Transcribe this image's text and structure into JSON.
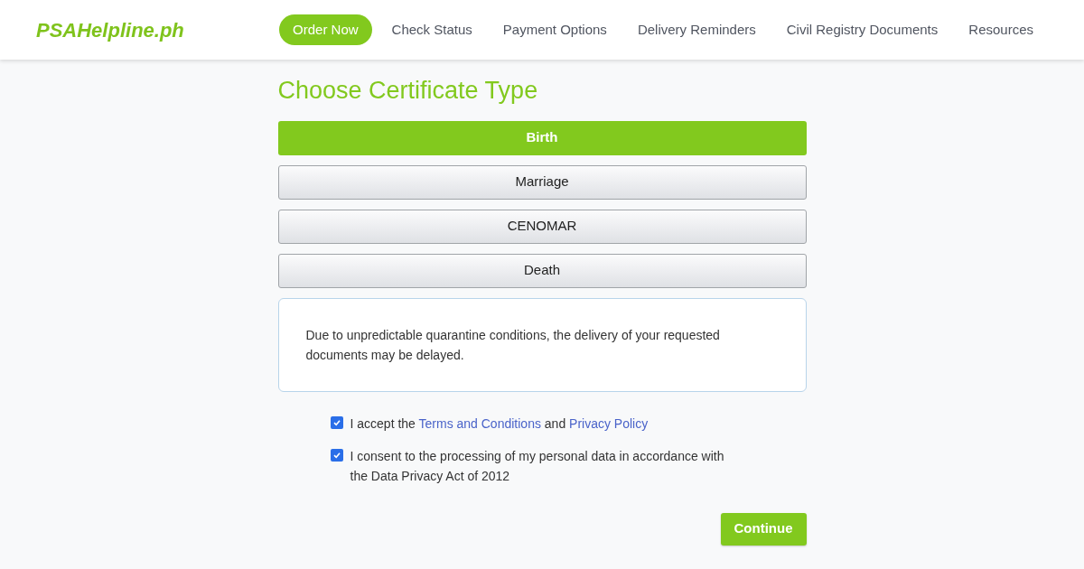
{
  "header": {
    "logo": "PSAHelpline.ph",
    "nav": [
      {
        "label": "Order Now",
        "selected": true
      },
      {
        "label": "Check Status",
        "selected": false
      },
      {
        "label": "Payment Options",
        "selected": false
      },
      {
        "label": "Delivery Reminders",
        "selected": false
      },
      {
        "label": "Civil Registry Documents",
        "selected": false
      },
      {
        "label": "Resources",
        "selected": false
      }
    ]
  },
  "form": {
    "title": "Choose Certificate Type",
    "options": [
      {
        "label": "Birth",
        "selected": true
      },
      {
        "label": "Marriage",
        "selected": false
      },
      {
        "label": "CENOMAR",
        "selected": false
      },
      {
        "label": "Death",
        "selected": false
      }
    ],
    "notice": "Due to unpredictable quarantine conditions, the delivery of your requested documents may be delayed.",
    "agreements": [
      {
        "checked": true,
        "parts": [
          {
            "kind": "text",
            "text": "I accept the "
          },
          {
            "kind": "link",
            "text": "Terms and Conditions"
          },
          {
            "kind": "text",
            "text": " and "
          },
          {
            "kind": "link",
            "text": "Privacy Policy"
          }
        ]
      },
      {
        "checked": true,
        "parts": [
          {
            "kind": "text",
            "text": "I consent to the processing of my personal data in accordance with the Data Privacy Act of 2012"
          }
        ]
      }
    ],
    "submit": "Continue"
  }
}
